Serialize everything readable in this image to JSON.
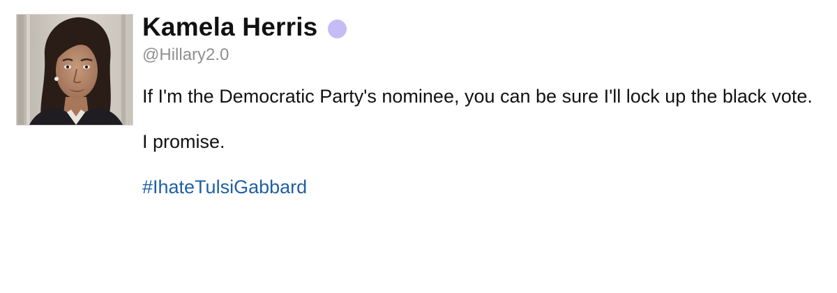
{
  "user": {
    "display_name": "Kamela Herris",
    "handle": "@Hillary2.0",
    "status_dot_color": "#c4bcf5"
  },
  "tweet": {
    "line1": "If I'm the Democratic Party's nominee, you can be sure I'll lock up the black vote.",
    "line2": "I promise.",
    "hashtag": "#IhateTulsiGabbard",
    "hashtag_color": "#1f5fa6"
  },
  "icons": {
    "avatar": "profile-photo-icon"
  }
}
